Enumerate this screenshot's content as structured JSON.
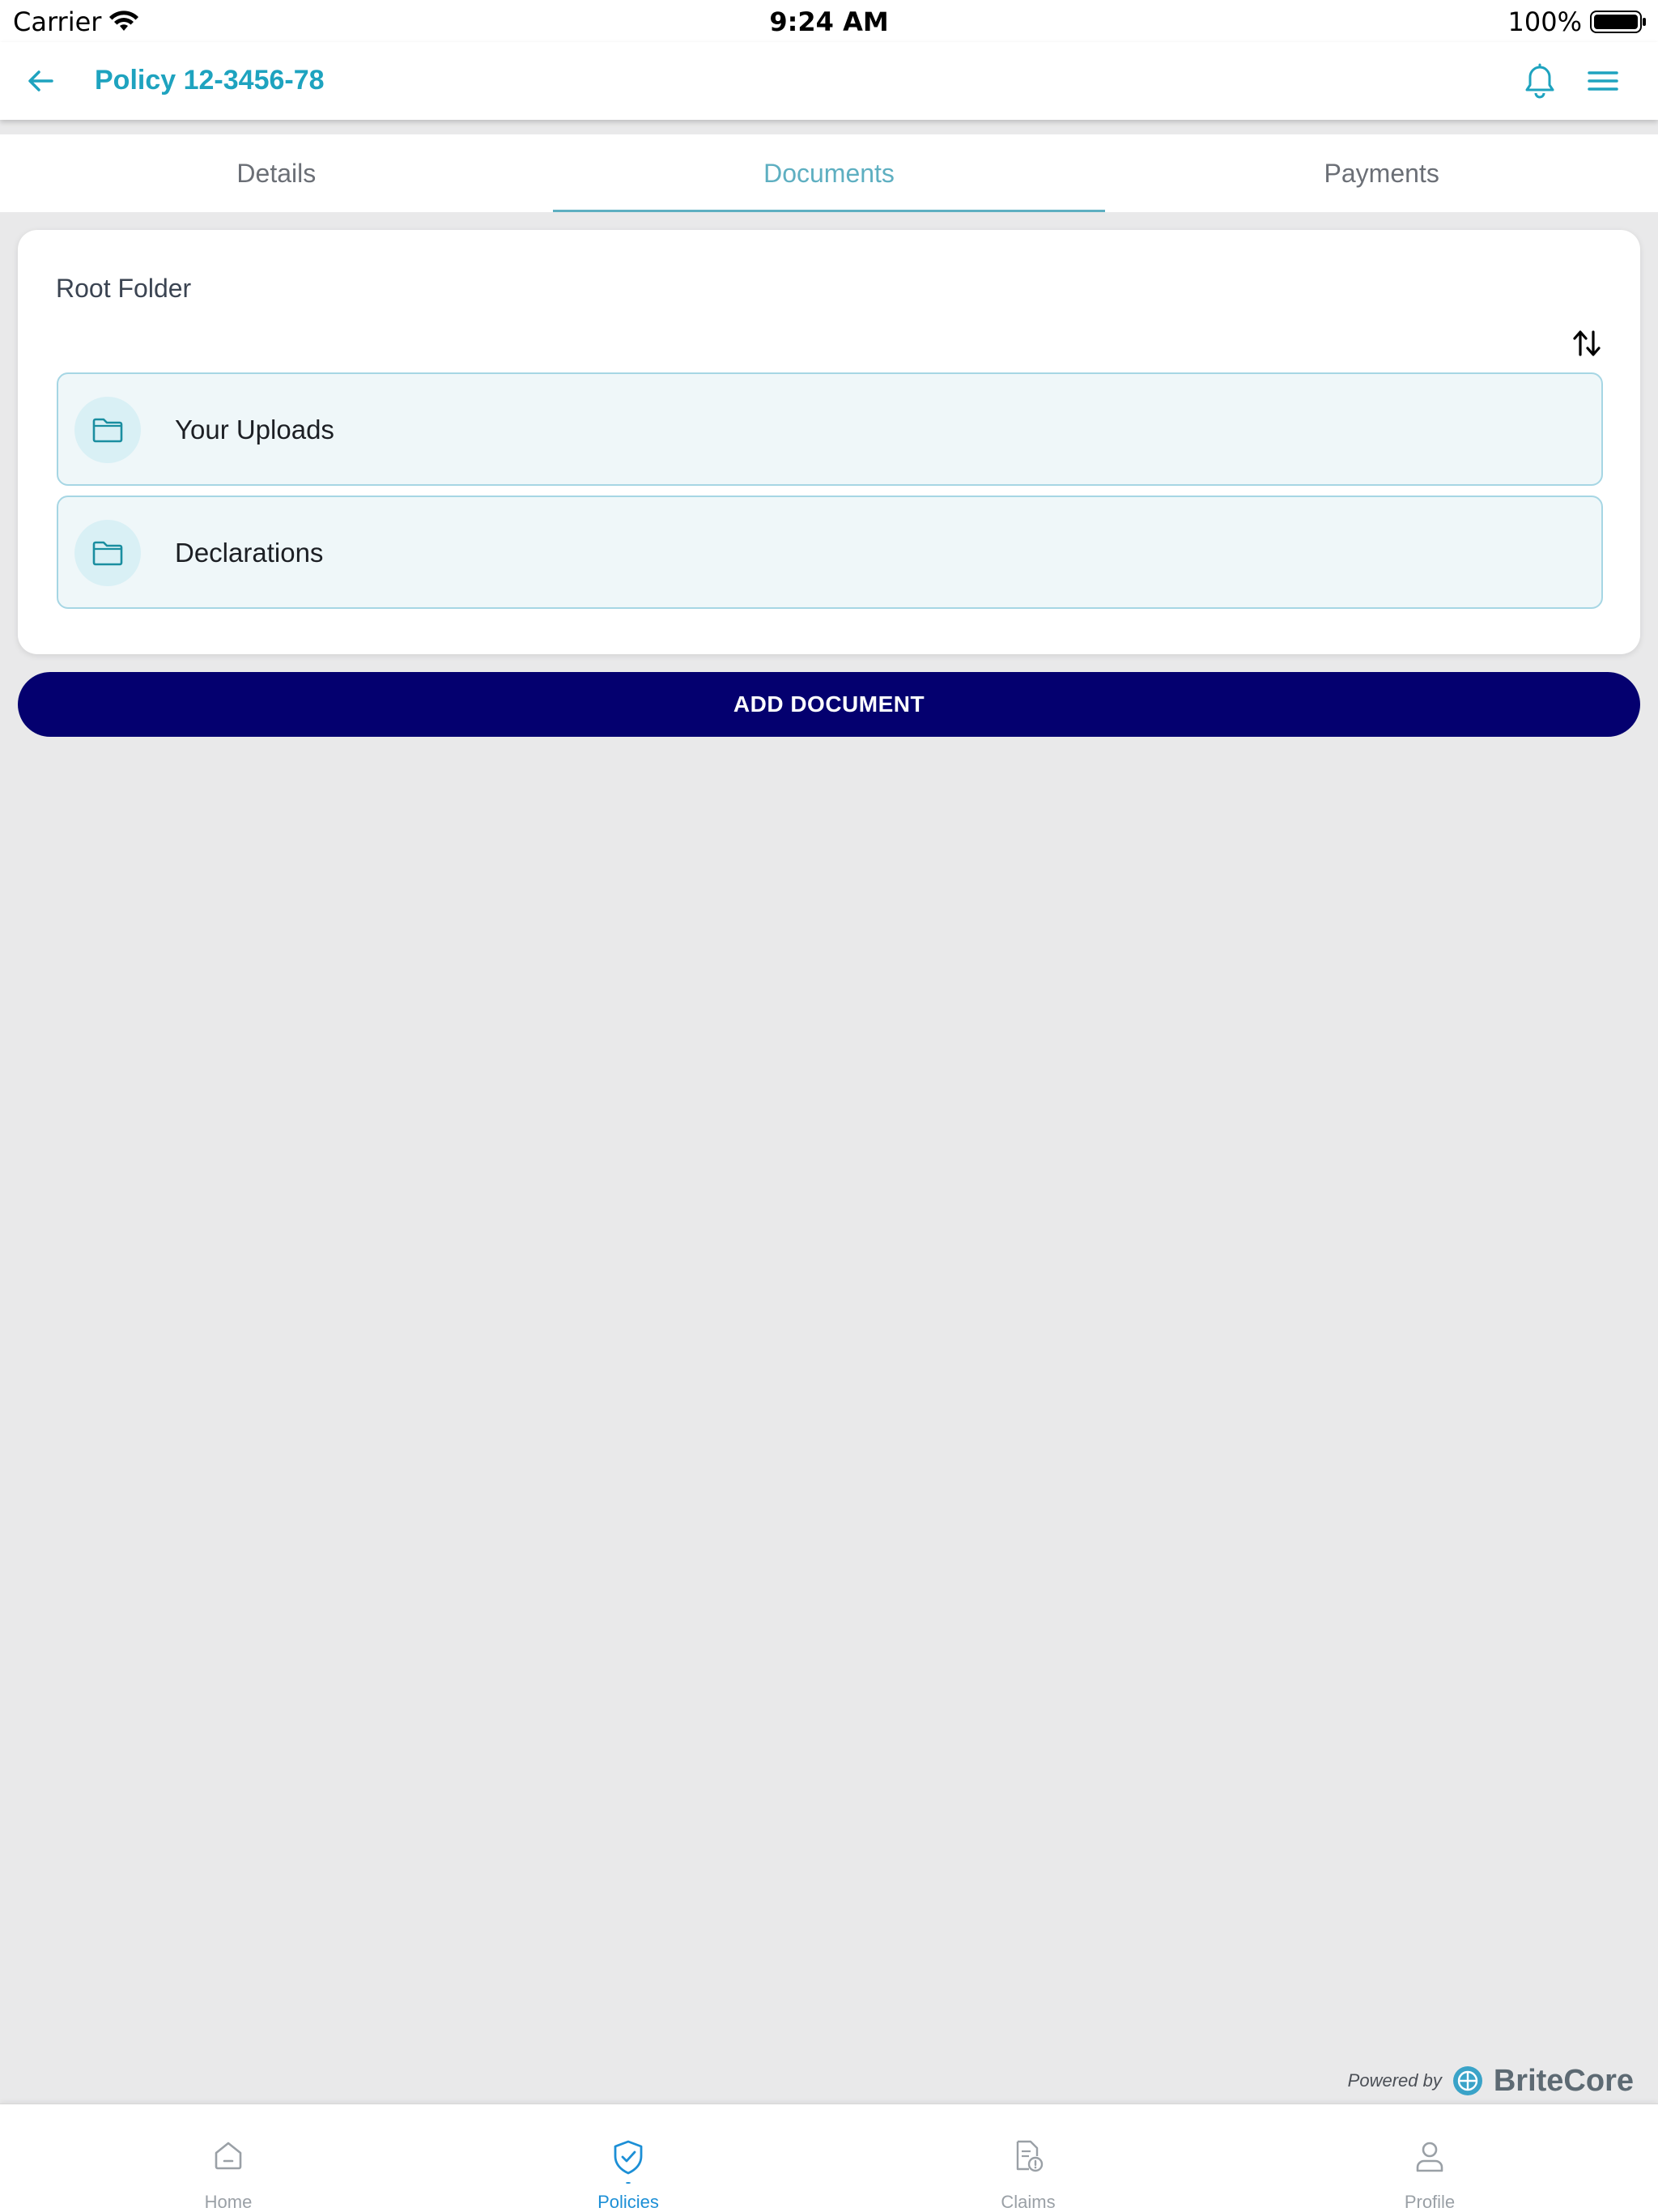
{
  "status_bar": {
    "carrier": "Carrier",
    "time": "9:24 AM",
    "battery": "100%"
  },
  "app_bar": {
    "title": "Policy 12-3456-78",
    "back_icon": "arrow-left-icon",
    "bell_icon": "bell-icon",
    "menu_icon": "hamburger-menu-icon"
  },
  "tabs": [
    {
      "label": "Details",
      "active": false
    },
    {
      "label": "Documents",
      "active": true
    },
    {
      "label": "Payments",
      "active": false
    }
  ],
  "documents": {
    "folder_title": "Root Folder",
    "sort_icon": "sort-arrows-icon",
    "folders": [
      {
        "label": "Your Uploads",
        "icon": "folder-icon"
      },
      {
        "label": "Declarations",
        "icon": "folder-icon"
      }
    ],
    "add_button": "ADD DOCUMENT"
  },
  "footer": {
    "powered_by": "Powered by",
    "brand": "BriteCore"
  },
  "bottom_nav": [
    {
      "label": "Home",
      "icon": "home-icon",
      "active": false
    },
    {
      "label": "Policies",
      "icon": "shield-check-icon",
      "active": true
    },
    {
      "label": "Claims",
      "icon": "claim-document-icon",
      "active": false
    },
    {
      "label": "Profile",
      "icon": "user-icon",
      "active": false
    }
  ],
  "colors": {
    "accent": "#1ea3bf",
    "tab_active": "#5eafc1",
    "primary_button": "#04006f",
    "folder_bg": "#eff7f9",
    "folder_border": "#a6d6e4",
    "nav_active": "#1c8fd6",
    "background": "#e9e9ea"
  }
}
